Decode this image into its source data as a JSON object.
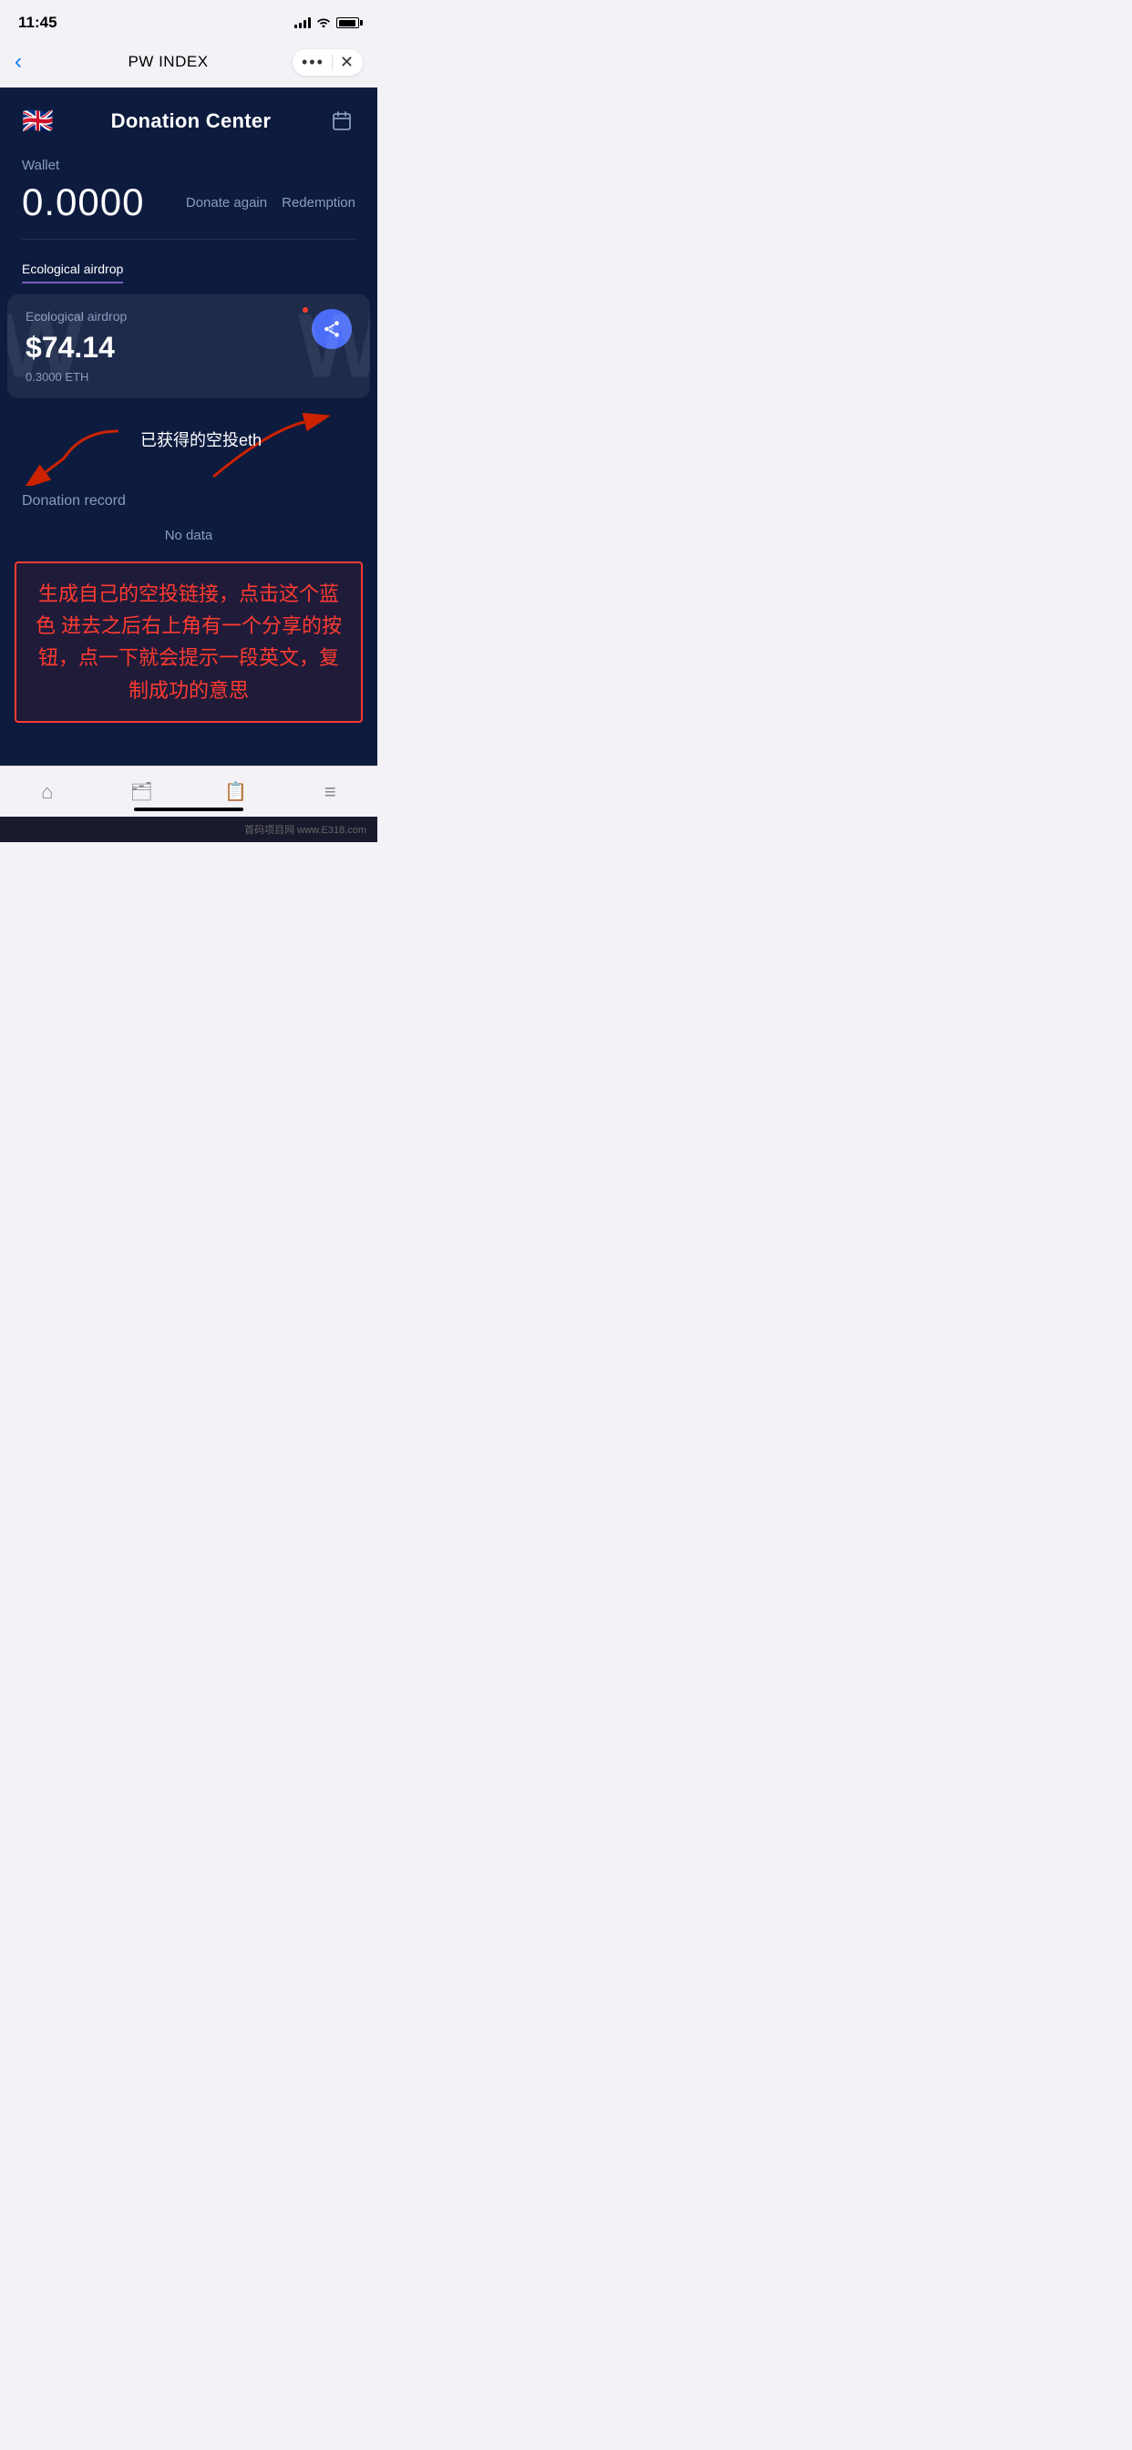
{
  "status_bar": {
    "time": "11:45"
  },
  "nav": {
    "back_icon": "‹",
    "title": "PW INDEX",
    "dots": "•••",
    "close": "✕"
  },
  "header": {
    "flag": "🇬🇧",
    "title": "Donation Center"
  },
  "wallet": {
    "label": "Wallet",
    "amount": "0.0000",
    "donate_again": "Donate again",
    "redemption": "Redemption"
  },
  "tabs": [
    {
      "label": "Ecological airdrop",
      "active": true
    },
    {
      "label": "",
      "active": false
    }
  ],
  "airdrop": {
    "label": "Ecological airdrop",
    "amount": "$74.14",
    "eth_amount": "0.3000 ETH"
  },
  "annotation": {
    "zh_text": "已获得的空投eth"
  },
  "donation_record": {
    "label": "Donation record",
    "no_data": "No data"
  },
  "annotation_box": {
    "text": "生成自己的空投链接，点击这个蓝色 进去之后右上角有一个分享的按钮，点一下就会提示一段英文，复制成功的意思"
  },
  "bottom_tabs": [
    {
      "icon": "⌂",
      "name": "home"
    },
    {
      "icon": "💼",
      "name": "wallet"
    },
    {
      "icon": "📅",
      "name": "calendar"
    },
    {
      "icon": "≡",
      "name": "menu"
    }
  ],
  "watermark": "首码项目网 www.E318.com"
}
